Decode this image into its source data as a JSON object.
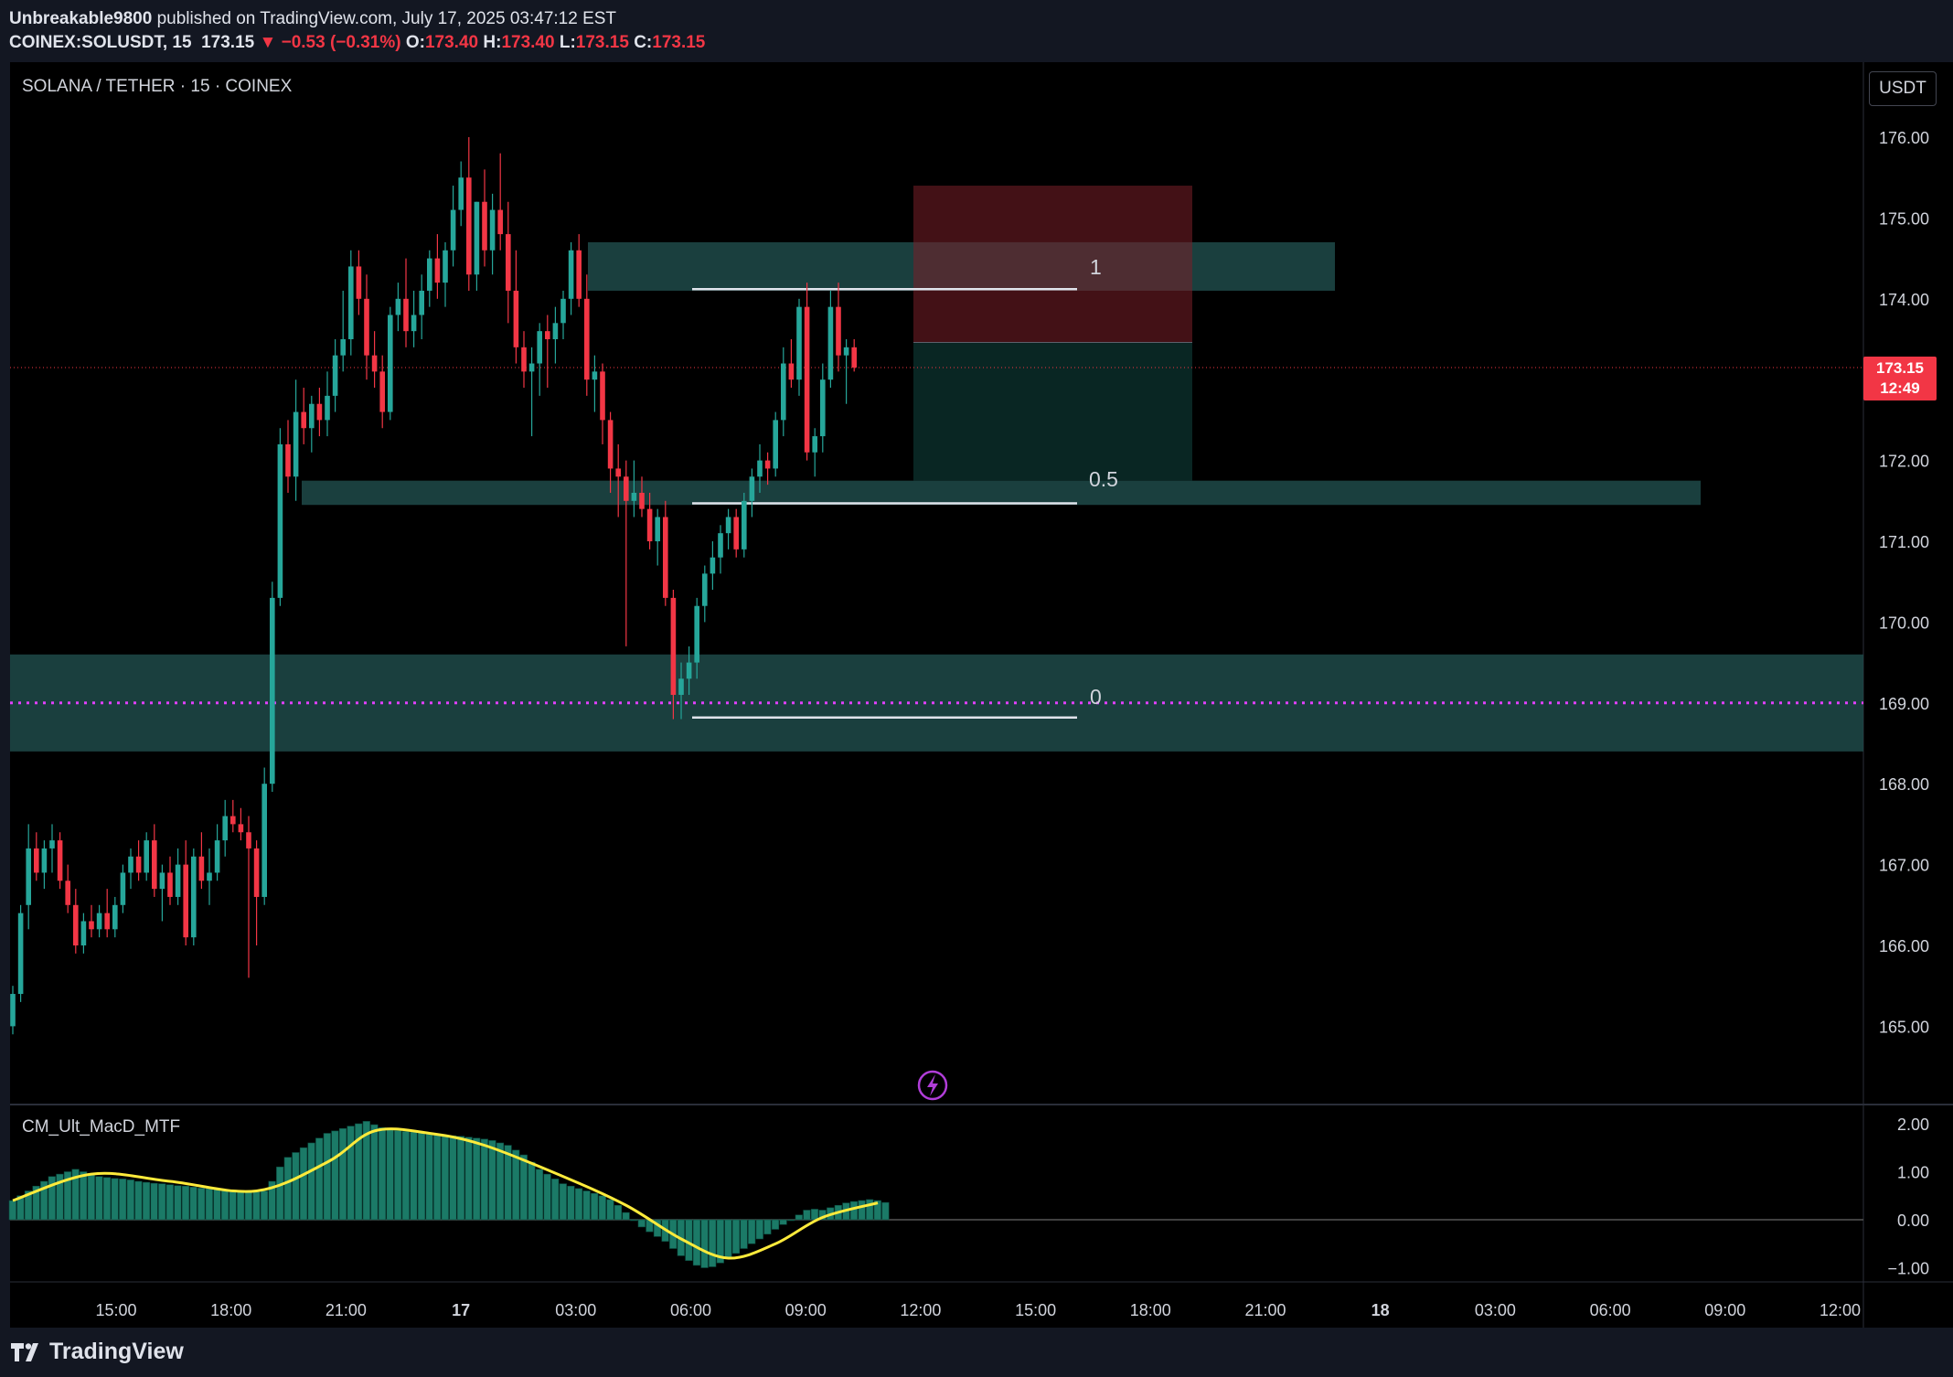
{
  "header": {
    "publisher": "Unbreakable9800",
    "published_text": "published on TradingView.com, July 17, 2025 03:47:12 EST",
    "symbol_line": "COINEX:SOLUSDT, 15",
    "last": "173.15",
    "change": "▼ −0.53 (−0.31%)",
    "o_label": "O:",
    "o_value": "173.40",
    "h_label": "H:",
    "h_value": "173.40",
    "l_label": "L:",
    "l_value": "173.15",
    "c_label": "C:",
    "c_value": "173.15"
  },
  "symbol_title": "SOLANA / TETHER · 15 · COINEX",
  "currency_button": "USDT",
  "current_price": {
    "price": "173.15",
    "countdown": "12:49"
  },
  "indicator_title": "CM_Ult_MacD_MTF",
  "footer": {
    "brand": "TradingView"
  },
  "colors": {
    "up": "#26a69a",
    "down": "#f23645",
    "zone": "#1e4a49",
    "signal": "#ffeb3b",
    "fib_dot": "#e040fb"
  },
  "chart_data": {
    "type": "candlestick",
    "title": "SOLANA / TETHER · 15 · COINEX",
    "ylim": [
      164.0,
      176.4
    ],
    "y_ticks": [
      "176.00",
      "175.00",
      "174.00",
      "173.00",
      "172.00",
      "171.00",
      "170.00",
      "169.00",
      "168.00",
      "167.00",
      "166.00",
      "165.00"
    ],
    "x_ticks": [
      "15:00",
      "18:00",
      "21:00",
      "17",
      "03:00",
      "06:00",
      "09:00",
      "12:00",
      "15:00",
      "18:00",
      "21:00",
      "18",
      "03:00",
      "06:00",
      "09:00",
      "12:00"
    ],
    "candles_ohlc": [
      [
        165.0,
        165.5,
        164.9,
        165.4
      ],
      [
        165.4,
        166.5,
        165.3,
        166.4
      ],
      [
        166.5,
        167.5,
        166.2,
        167.2
      ],
      [
        167.2,
        167.4,
        166.8,
        166.9
      ],
      [
        166.9,
        167.3,
        166.7,
        167.2
      ],
      [
        167.2,
        167.5,
        166.9,
        167.3
      ],
      [
        167.3,
        167.4,
        166.7,
        166.8
      ],
      [
        166.8,
        167.0,
        166.4,
        166.5
      ],
      [
        166.5,
        166.7,
        165.9,
        166.0
      ],
      [
        166.0,
        166.4,
        165.9,
        166.3
      ],
      [
        166.3,
        166.5,
        166.1,
        166.2
      ],
      [
        166.2,
        166.5,
        166.1,
        166.4
      ],
      [
        166.4,
        166.7,
        166.1,
        166.2
      ],
      [
        166.2,
        166.6,
        166.1,
        166.5
      ],
      [
        166.5,
        167.0,
        166.4,
        166.9
      ],
      [
        166.9,
        167.2,
        166.7,
        167.1
      ],
      [
        167.1,
        167.3,
        166.8,
        166.9
      ],
      [
        166.9,
        167.4,
        166.8,
        167.3
      ],
      [
        167.3,
        167.5,
        166.6,
        166.7
      ],
      [
        166.7,
        167.0,
        166.3,
        166.9
      ],
      [
        166.9,
        167.1,
        166.5,
        166.6
      ],
      [
        166.6,
        167.2,
        166.5,
        167.0
      ],
      [
        167.0,
        167.3,
        166.0,
        166.1
      ],
      [
        166.1,
        167.2,
        166.0,
        167.1
      ],
      [
        167.1,
        167.4,
        166.7,
        166.8
      ],
      [
        166.8,
        167.2,
        166.5,
        166.9
      ],
      [
        166.9,
        167.5,
        166.8,
        167.3
      ],
      [
        167.3,
        167.8,
        167.1,
        167.6
      ],
      [
        167.6,
        167.8,
        167.4,
        167.5
      ],
      [
        167.5,
        167.7,
        167.3,
        167.4
      ],
      [
        167.4,
        167.6,
        165.6,
        167.2
      ],
      [
        167.2,
        167.3,
        166.0,
        166.6
      ],
      [
        166.6,
        168.2,
        166.5,
        168.0
      ],
      [
        168.0,
        170.5,
        167.9,
        170.3
      ],
      [
        170.3,
        172.4,
        170.2,
        172.2
      ],
      [
        172.2,
        172.5,
        171.6,
        171.8
      ],
      [
        171.8,
        173.0,
        171.5,
        172.6
      ],
      [
        172.6,
        172.9,
        172.2,
        172.4
      ],
      [
        172.4,
        172.8,
        172.1,
        172.7
      ],
      [
        172.7,
        172.9,
        172.3,
        172.5
      ],
      [
        172.5,
        173.1,
        172.3,
        172.8
      ],
      [
        172.8,
        173.5,
        172.6,
        173.3
      ],
      [
        173.3,
        174.1,
        173.1,
        173.5
      ],
      [
        173.5,
        174.6,
        173.3,
        174.4
      ],
      [
        174.4,
        174.6,
        173.8,
        174.0
      ],
      [
        174.0,
        174.3,
        173.0,
        173.3
      ],
      [
        173.3,
        173.6,
        172.9,
        173.1
      ],
      [
        173.1,
        173.3,
        172.4,
        172.6
      ],
      [
        172.6,
        173.9,
        172.5,
        173.8
      ],
      [
        173.8,
        174.2,
        173.6,
        174.0
      ],
      [
        174.0,
        174.5,
        173.4,
        173.6
      ],
      [
        173.6,
        174.1,
        173.4,
        173.8
      ],
      [
        173.8,
        174.3,
        173.5,
        174.1
      ],
      [
        174.1,
        174.6,
        173.9,
        174.5
      ],
      [
        174.5,
        174.8,
        174.0,
        174.2
      ],
      [
        174.2,
        174.7,
        173.9,
        174.6
      ],
      [
        174.6,
        175.4,
        174.4,
        175.1
      ],
      [
        175.1,
        175.7,
        174.9,
        175.5
      ],
      [
        175.5,
        176.0,
        174.1,
        174.3
      ],
      [
        174.3,
        175.2,
        174.1,
        175.2
      ],
      [
        175.2,
        175.6,
        174.4,
        174.6
      ],
      [
        174.6,
        175.3,
        174.3,
        175.1
      ],
      [
        175.1,
        175.8,
        174.6,
        174.8
      ],
      [
        174.8,
        175.2,
        173.7,
        174.1
      ],
      [
        174.1,
        174.6,
        173.2,
        173.4
      ],
      [
        173.4,
        173.6,
        172.9,
        173.1
      ],
      [
        173.1,
        173.4,
        172.3,
        173.2
      ],
      [
        173.2,
        173.7,
        172.8,
        173.6
      ],
      [
        173.6,
        173.8,
        172.9,
        173.5
      ],
      [
        173.5,
        173.9,
        173.2,
        173.7
      ],
      [
        173.7,
        174.1,
        173.5,
        174.0
      ],
      [
        174.0,
        174.7,
        173.8,
        174.6
      ],
      [
        174.6,
        174.8,
        173.9,
        174.0
      ],
      [
        174.0,
        174.3,
        172.8,
        173.0
      ],
      [
        173.0,
        173.3,
        172.6,
        173.1
      ],
      [
        173.1,
        173.2,
        172.2,
        172.5
      ],
      [
        172.5,
        172.6,
        171.6,
        171.9
      ],
      [
        171.9,
        172.2,
        171.3,
        171.8
      ],
      [
        171.8,
        172.0,
        169.7,
        171.5
      ],
      [
        171.5,
        172.0,
        171.3,
        171.6
      ],
      [
        171.6,
        171.8,
        171.3,
        171.4
      ],
      [
        171.4,
        171.6,
        170.9,
        171.0
      ],
      [
        171.0,
        171.4,
        170.7,
        171.3
      ],
      [
        171.3,
        171.5,
        170.2,
        170.3
      ],
      [
        170.3,
        170.4,
        168.8,
        169.1
      ],
      [
        169.1,
        169.5,
        168.8,
        169.3
      ],
      [
        169.3,
        169.7,
        169.1,
        169.5
      ],
      [
        169.5,
        170.3,
        169.3,
        170.2
      ],
      [
        170.2,
        170.7,
        170.0,
        170.6
      ],
      [
        170.6,
        171.0,
        170.4,
        170.8
      ],
      [
        170.8,
        171.2,
        170.6,
        171.1
      ],
      [
        171.1,
        171.4,
        170.9,
        171.3
      ],
      [
        171.3,
        171.4,
        170.8,
        170.9
      ],
      [
        170.9,
        171.6,
        170.8,
        171.5
      ],
      [
        171.5,
        171.9,
        171.3,
        171.8
      ],
      [
        171.8,
        172.2,
        171.6,
        172.0
      ],
      [
        172.0,
        172.1,
        171.7,
        171.9
      ],
      [
        171.9,
        172.6,
        171.8,
        172.5
      ],
      [
        172.5,
        173.4,
        172.3,
        173.2
      ],
      [
        173.2,
        173.5,
        172.9,
        173.0
      ],
      [
        173.0,
        174.0,
        172.8,
        173.9
      ],
      [
        173.9,
        174.2,
        172.0,
        172.1
      ],
      [
        172.1,
        172.4,
        171.8,
        172.3
      ],
      [
        172.3,
        173.2,
        172.1,
        173.0
      ],
      [
        173.0,
        174.1,
        172.9,
        173.9
      ],
      [
        173.9,
        174.2,
        173.1,
        173.3
      ],
      [
        173.3,
        173.5,
        172.7,
        173.4
      ],
      [
        173.4,
        173.5,
        173.1,
        173.15
      ]
    ],
    "zones": [
      {
        "from": 174.1,
        "to": 174.7,
        "label": "1"
      },
      {
        "from": 171.45,
        "to": 171.75,
        "label": "0.5"
      },
      {
        "from": 168.4,
        "to": 169.6,
        "label": "0"
      }
    ],
    "fib_levels": [
      {
        "value": 174.12,
        "label": "1"
      },
      {
        "value": 171.47,
        "label": "0.5"
      },
      {
        "value": 168.82,
        "label": "0"
      }
    ],
    "position": {
      "stop": 175.4,
      "entry": 173.46,
      "target": 171.75
    },
    "dotted_level": 169.0,
    "macd": {
      "ylim": [
        -1.3,
        2.2
      ],
      "y_ticks": [
        "2.00",
        "1.00",
        "0.00",
        "−1.00"
      ],
      "histogram": [
        0.4,
        0.5,
        0.6,
        0.7,
        0.8,
        0.9,
        0.95,
        1.0,
        1.05,
        1.0,
        0.95,
        0.9,
        0.88,
        0.86,
        0.85,
        0.83,
        0.8,
        0.78,
        0.76,
        0.75,
        0.73,
        0.71,
        0.7,
        0.68,
        0.66,
        0.65,
        0.64,
        0.63,
        0.62,
        0.61,
        0.6,
        0.58,
        0.6,
        0.8,
        1.1,
        1.3,
        1.4,
        1.5,
        1.6,
        1.7,
        1.8,
        1.85,
        1.9,
        1.95,
        2.0,
        2.05,
        1.98,
        1.92,
        1.88,
        1.86,
        1.84,
        1.83,
        1.82,
        1.8,
        1.78,
        1.76,
        1.75,
        1.74,
        1.72,
        1.7,
        1.68,
        1.65,
        1.6,
        1.55,
        1.45,
        1.35,
        1.2,
        1.05,
        0.95,
        0.85,
        0.75,
        0.7,
        0.65,
        0.6,
        0.55,
        0.5,
        0.42,
        0.3,
        0.15,
        0.0,
        -0.15,
        -0.25,
        -0.35,
        -0.45,
        -0.6,
        -0.75,
        -0.85,
        -0.95,
        -1.0,
        -0.98,
        -0.9,
        -0.8,
        -0.7,
        -0.6,
        -0.5,
        -0.4,
        -0.3,
        -0.2,
        -0.1,
        0.0,
        0.1,
        0.2,
        0.22,
        0.2,
        0.25,
        0.3,
        0.35,
        0.38,
        0.4,
        0.42,
        0.4,
        0.36
      ],
      "signal_points": [
        [
          0,
          0.4
        ],
        [
          10,
          0.95
        ],
        [
          20,
          0.8
        ],
        [
          31,
          0.6
        ],
        [
          40,
          1.2
        ],
        [
          46,
          1.85
        ],
        [
          53,
          1.8
        ],
        [
          60,
          1.55
        ],
        [
          70,
          0.9
        ],
        [
          78,
          0.3
        ],
        [
          85,
          -0.4
        ],
        [
          91,
          -0.8
        ],
        [
          97,
          -0.5
        ],
        [
          103,
          0.05
        ],
        [
          110,
          0.35
        ]
      ]
    }
  }
}
